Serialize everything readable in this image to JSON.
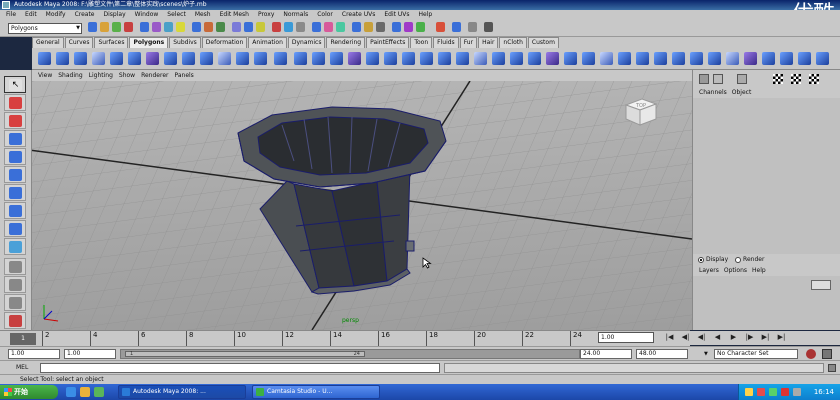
{
  "window": {
    "title": "Autodesk Maya 2008: F:\\雕塑文件\\第二章\\整体实践\\scenes\\炉子.mb",
    "watermark": "优酷"
  },
  "menubar": [
    "File",
    "Edit",
    "Modify",
    "Create",
    "Display",
    "Window",
    "Select",
    "Mesh",
    "Edit Mesh",
    "Proxy",
    "Normals",
    "Color",
    "Create UVs",
    "Edit UVs",
    "Help"
  ],
  "statusline": {
    "mode": "Polygons"
  },
  "shelf": {
    "tabs": [
      "General",
      "Curves",
      "Surfaces",
      "Polygons",
      "Subdivs",
      "Deformation",
      "Animation",
      "Dynamics",
      "Rendering",
      "PaintEffects",
      "Toon",
      "Fluids",
      "Fur",
      "Hair",
      "nCloth",
      "Custom"
    ],
    "active_tab": "Polygons"
  },
  "panel_menu": [
    "View",
    "Shading",
    "Lighting",
    "Show",
    "Renderer",
    "Panels"
  ],
  "viewport": {
    "camera": "persp",
    "viewcube_label": "TOP"
  },
  "channel_box": {
    "menu": [
      "Channels",
      "Object"
    ],
    "layer_mode_display": "Display",
    "layer_mode_render": "Render",
    "layer_menu": [
      "Layers",
      "Options",
      "Help"
    ]
  },
  "time_slider": {
    "ticks": [
      "2",
      "4",
      "6",
      "8",
      "10",
      "12",
      "14",
      "16",
      "18",
      "20",
      "22",
      "24"
    ],
    "current_frame_marker": "1",
    "current_frame": "1.00"
  },
  "range_slider": {
    "start_time": "1.00",
    "playback_start": "1.00",
    "range_start_label": "1",
    "range_end_label": "24",
    "playback_end": "24.00",
    "end_time": "48.00",
    "character_set": "No Character Set"
  },
  "playback": {
    "buttons": [
      "|◀",
      "◀|",
      "◀|",
      "◀",
      "▶",
      "|▶",
      "▶|",
      "▶|"
    ]
  },
  "command_line": {
    "label": "MEL"
  },
  "help_line": {
    "text": "Select Tool: select an object"
  },
  "taskbar": {
    "start": "开始",
    "tasks": [
      {
        "label": "Autodesk Maya 2008: ...",
        "color": "#2a7bd8"
      },
      {
        "label": "Camtasia Studio - U...",
        "color": "#3cb043"
      }
    ],
    "clock": "16:14"
  }
}
